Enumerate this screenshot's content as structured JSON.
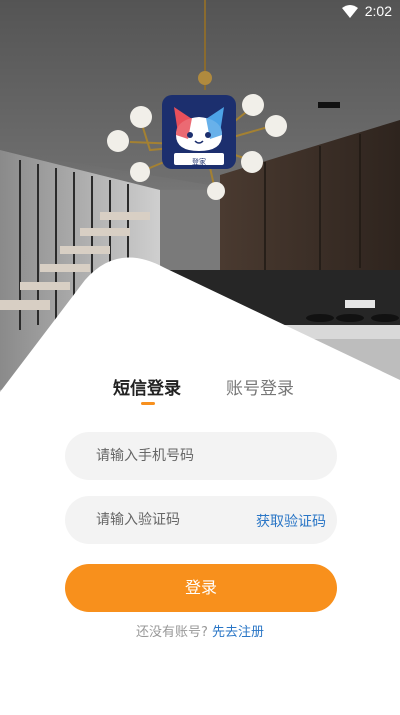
{
  "status_bar": {
    "time": "2:02",
    "wifi_icon": "wifi-icon"
  },
  "logo": {
    "text": "登家",
    "icon": "cat-logo-icon"
  },
  "tabs": [
    {
      "label": "短信登录",
      "active": true
    },
    {
      "label": "账号登录",
      "active": false
    }
  ],
  "phone_field": {
    "placeholder": "请输入手机号码"
  },
  "code_field": {
    "placeholder": "请输入验证码",
    "get_code_label": "获取验证码"
  },
  "login_button": {
    "label": "登录"
  },
  "register": {
    "question": "还没有账号?",
    "link_label": "先去注册"
  },
  "colors": {
    "accent": "#f8901c",
    "link": "#2a76c6"
  }
}
